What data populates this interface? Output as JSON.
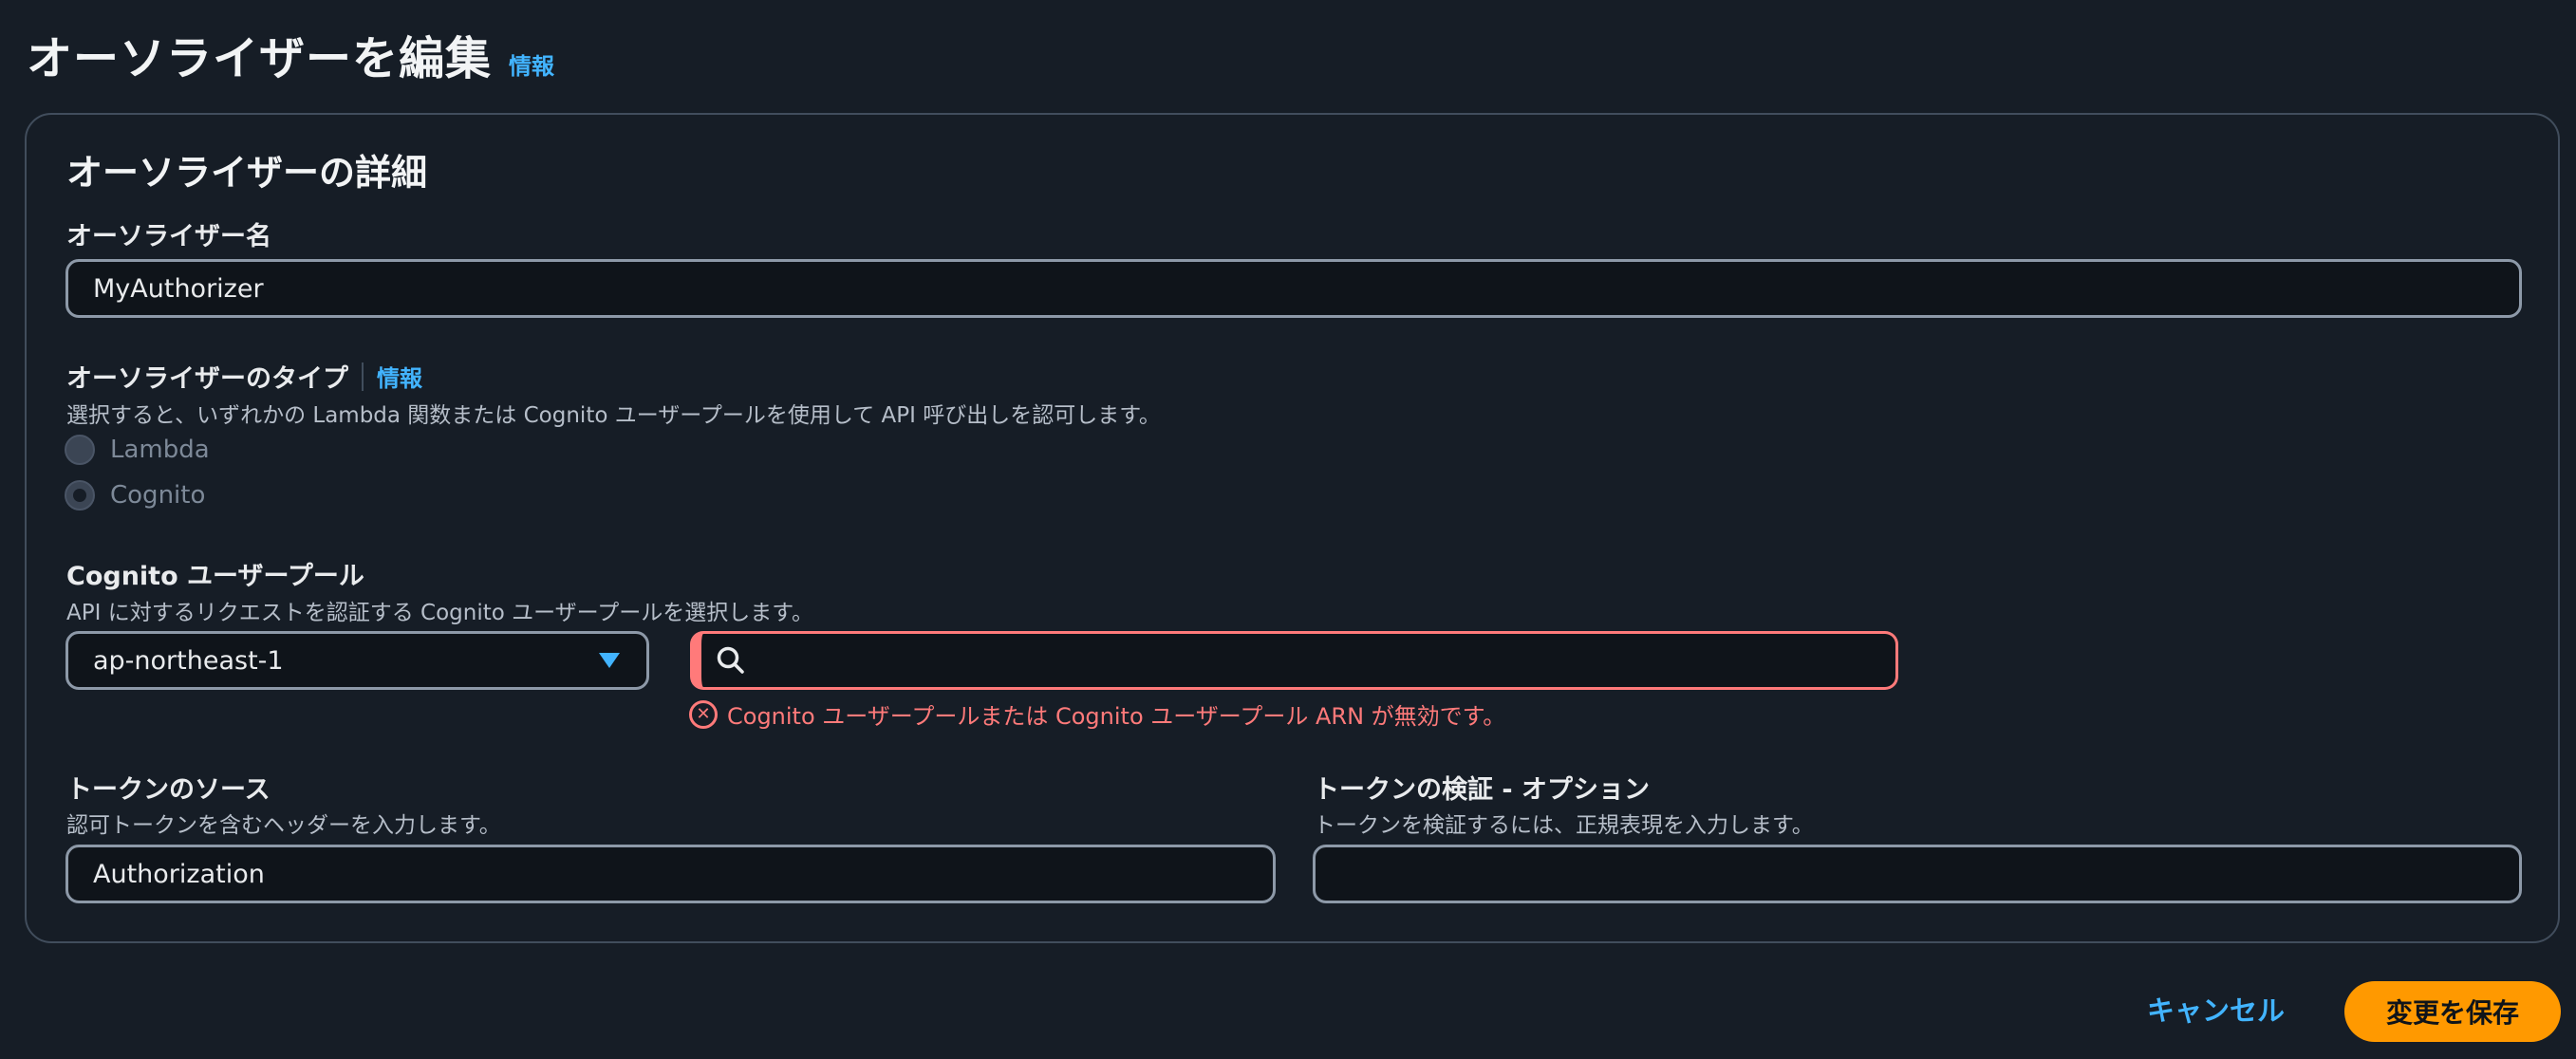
{
  "header": {
    "title": "オーソライザーを編集",
    "info_link": "情報"
  },
  "details": {
    "section_title": "オーソライザーの詳細",
    "name": {
      "label": "オーソライザー名",
      "value": "MyAuthorizer"
    },
    "type": {
      "label": "オーソライザーのタイプ",
      "info_link": "情報",
      "description": "選択すると、いずれかの Lambda 関数または Cognito ユーザープールを使用して API 呼び出しを認可します。",
      "options": [
        "Lambda",
        "Cognito"
      ],
      "selected": "Cognito",
      "disabled": true
    },
    "user_pool": {
      "label": "Cognito ユーザープール",
      "description": "API に対するリクエストを認証する Cognito ユーザープールを選択します。",
      "region": "ap-northeast-1",
      "search_value": "",
      "error": "Cognito ユーザープールまたは Cognito ユーザープール ARN が無効です。"
    },
    "token_source": {
      "label": "トークンのソース",
      "description": "認可トークンを含むヘッダーを入力します。",
      "value": "Authorization"
    },
    "token_validation": {
      "label": "トークンの検証 - オプション",
      "description": "トークンを検証するには、正規表現を入力します。",
      "value": ""
    }
  },
  "actions": {
    "cancel": "キャンセル",
    "save": "変更を保存"
  },
  "colors": {
    "background": "#161d26",
    "accent_link": "#42b4ff",
    "error": "#ff7a7a",
    "primary_button": "#ff9900"
  },
  "icons": {
    "search": "search-icon",
    "error": "error-icon",
    "dropdown": "caret-down-icon"
  }
}
